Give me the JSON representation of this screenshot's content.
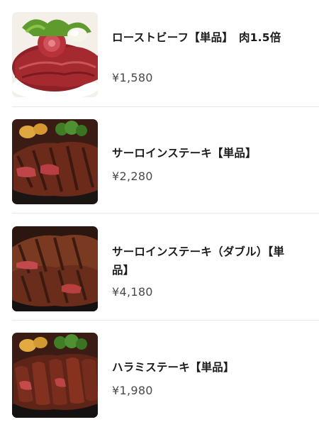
{
  "menu": {
    "items": [
      {
        "title": "ローストビーフ【単品】　肉1.5倍",
        "price": "¥1,580",
        "image": "roast-beef-photo"
      },
      {
        "title": "サーロインステーキ【単品】",
        "price": "¥2,280",
        "image": "sirloin-steak-photo"
      },
      {
        "title": "サーロインステーキ（ダブル）【単品】",
        "price": "¥4,180",
        "image": "sirloin-double-photo"
      },
      {
        "title": "ハラミステーキ【単品】",
        "price": "¥1,980",
        "image": "harami-steak-photo"
      }
    ]
  }
}
